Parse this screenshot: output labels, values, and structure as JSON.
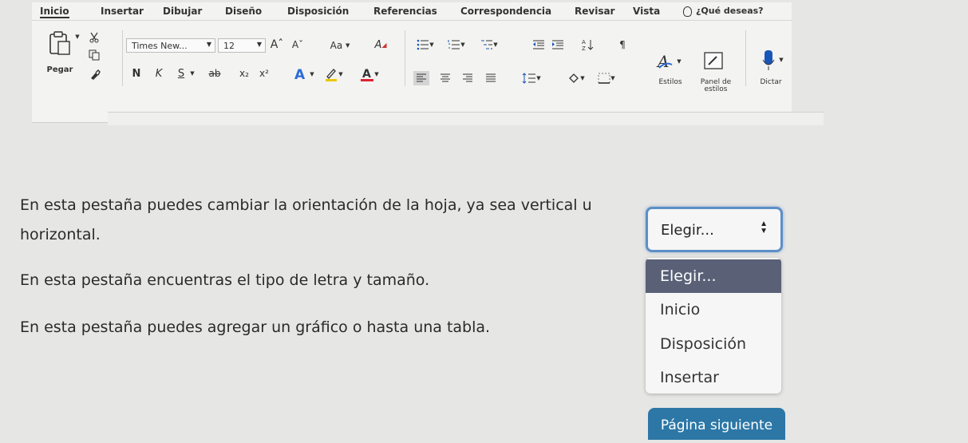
{
  "ribbon": {
    "tabs": [
      "Inicio",
      "Insertar",
      "Dibujar",
      "Diseño",
      "Disposición",
      "Referencias",
      "Correspondencia",
      "Revisar",
      "Vista"
    ],
    "help_text": "¿Qué deseas?",
    "paste_label": "Pegar",
    "font_name": "Times New...",
    "font_size": "12",
    "grow_font": "Aˆ",
    "shrink_font": "Aˇ",
    "change_case": "Aa",
    "bold": "N",
    "italic": "K",
    "underline": "S",
    "strike": "ab",
    "subscript": "x₂",
    "superscript": "x²",
    "pilcrow": "¶",
    "styles_label": "Estilos",
    "styles_pane_label": "Panel de estilos",
    "dictate_label": "Dictar"
  },
  "content": {
    "line1": "En esta pestaña puedes cambiar la orientación de la hoja, ya sea vertical u",
    "line1b": "horizontal.",
    "line2": "En esta pestaña encuentras el tipo de letra y tamaño.",
    "line3": "En esta pestaña puedes agregar un gráfico o hasta una tabla."
  },
  "select": {
    "value": "Elegir...",
    "options": [
      "Elegir...",
      "Inicio",
      "Disposición",
      "Insertar"
    ]
  },
  "next_button": "Página siguiente",
  "colors": {
    "accent_blue": "#2c77a6",
    "select_border": "#5c8fc6",
    "highlight_option": "#5a6177",
    "font_color_red": "#d23",
    "highlight_yellow": "#e8c800",
    "text_highlight_blue": "#2b6cd8"
  }
}
